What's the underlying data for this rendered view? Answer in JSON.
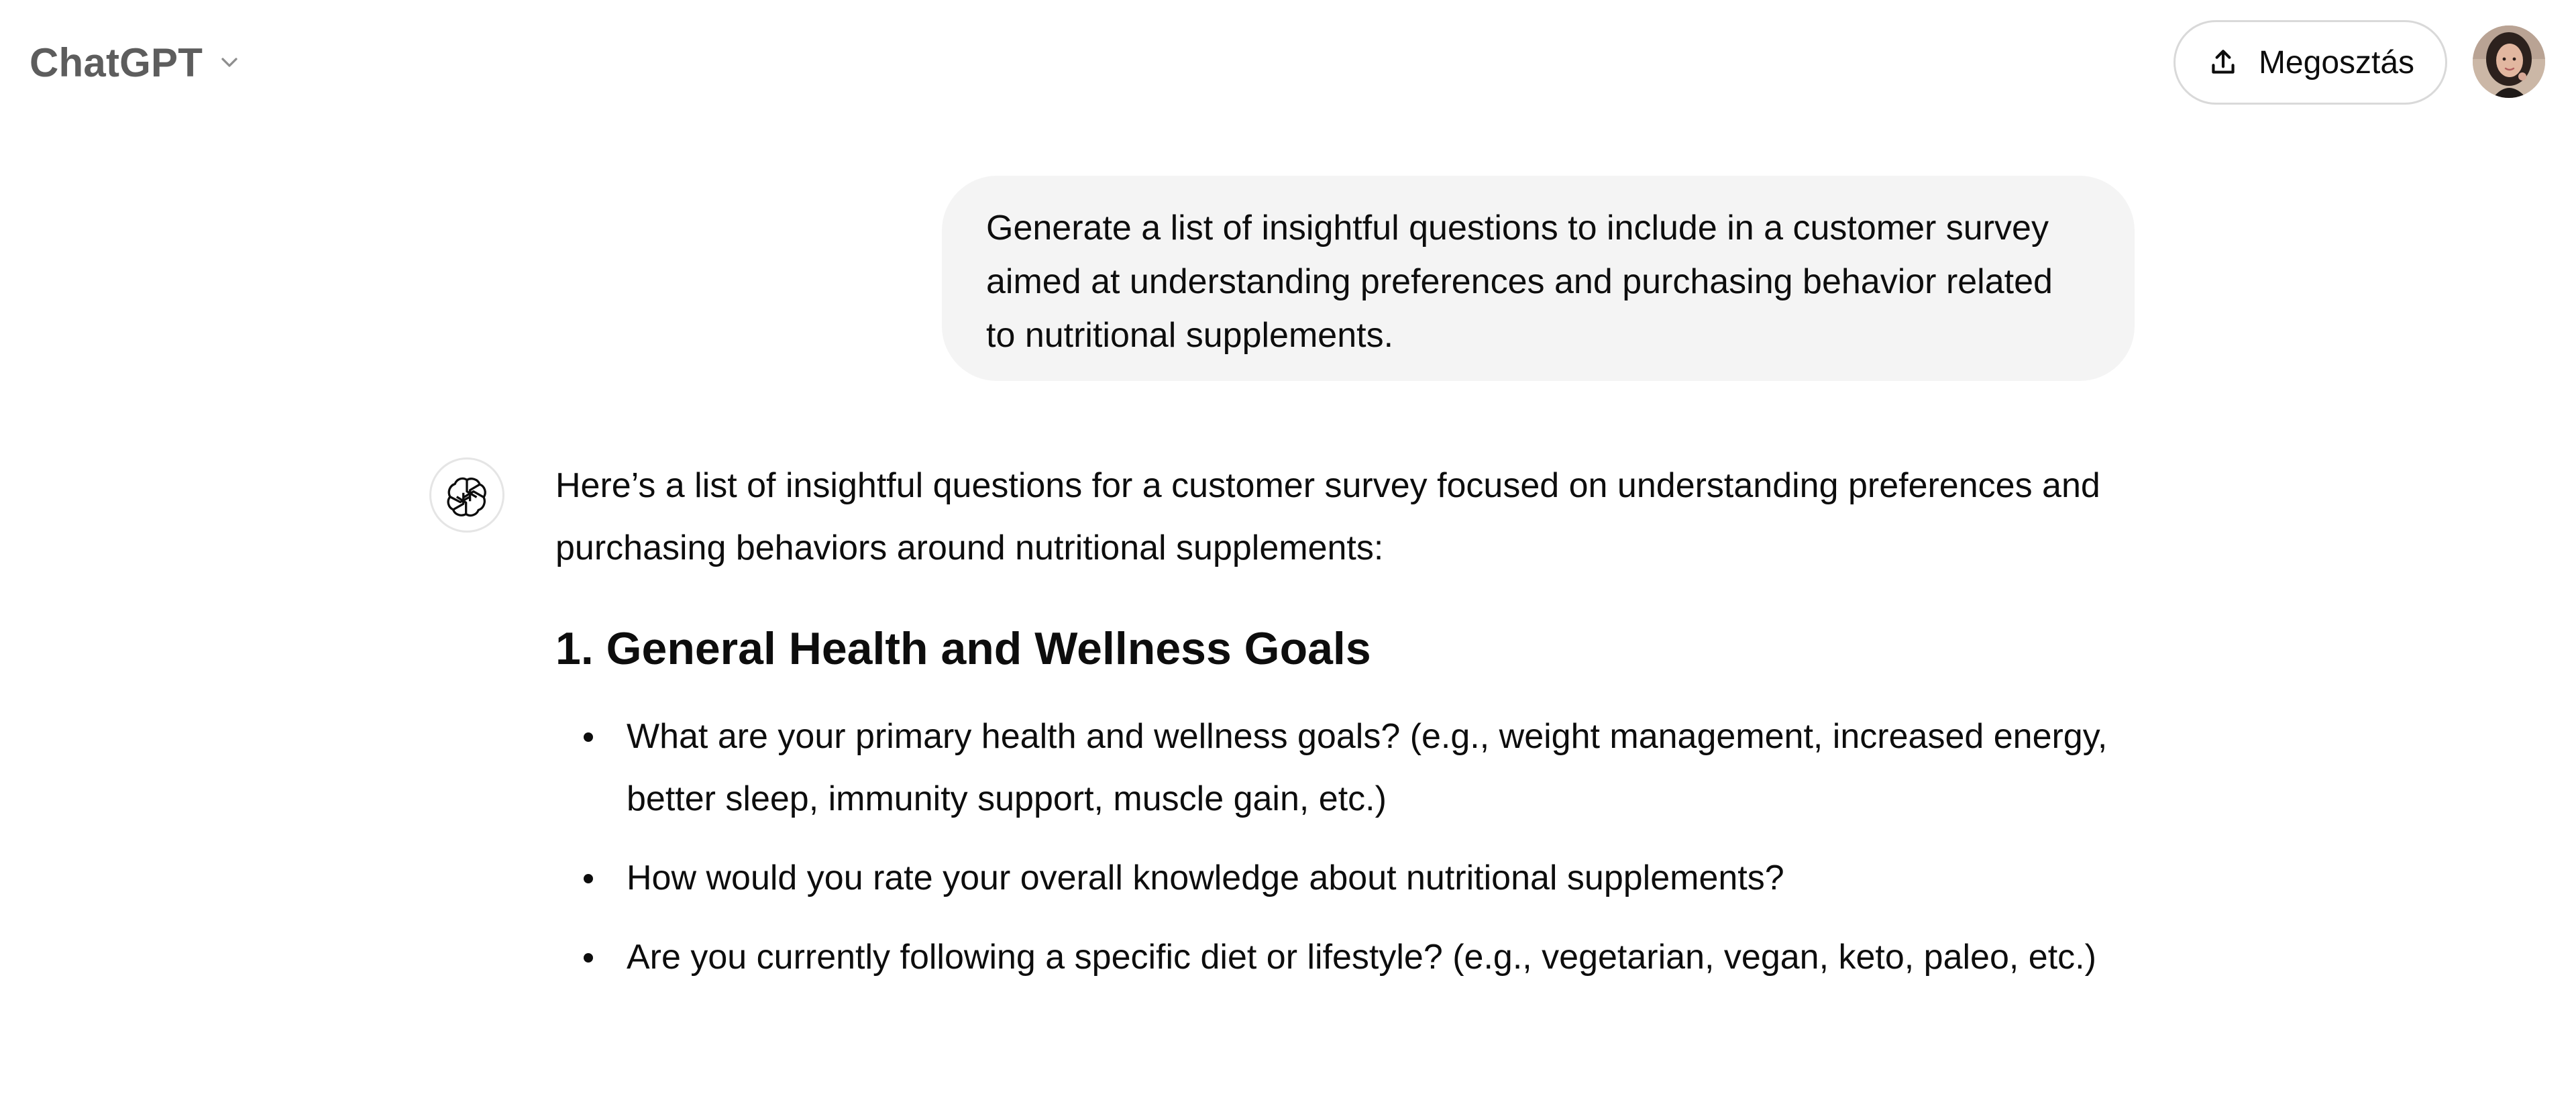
{
  "header": {
    "model_name": "ChatGPT",
    "share_label": "Megosztás"
  },
  "conversation": {
    "user_message": "Generate a list of insightful questions to include in a customer survey aimed at understanding preferences and purchasing behavior related to nutritional supplements.",
    "assistant": {
      "intro": "Here’s a list of insightful questions for a customer survey focused on understanding preferences and purchasing behaviors around nutritional supplements:",
      "section_heading": "1. General Health and Wellness Goals",
      "bullets": [
        "What are your primary health and wellness goals? (e.g., weight management, increased energy, better sleep, immunity support, muscle gain, etc.)",
        "How would you rate your overall knowledge about nutritional supplements?",
        "Are you currently following a specific diet or lifestyle? (e.g., vegetarian, vegan, keto, paleo, etc.)"
      ]
    }
  },
  "icons": {
    "chevron": "chevron-down-icon",
    "share": "share-upload-icon",
    "assistant": "openai-logo-icon",
    "avatar": "user-avatar"
  },
  "colors": {
    "model_name": "#5d5d5d",
    "user_bubble_bg": "#f4f4f4",
    "text": "#0d0d0d",
    "border": "#d9d9d9"
  }
}
